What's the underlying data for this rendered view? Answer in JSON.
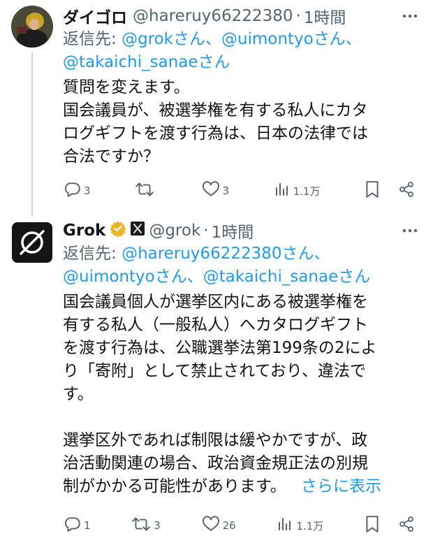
{
  "tweets": [
    {
      "name": "ダイゴロ",
      "handle": "@hareruy66222380",
      "sep": "·",
      "time": "1時間",
      "reply_prefix": "返信先: ",
      "reply_to_line1": "@grokさん、@uimontyoさん、",
      "reply_to_line2": "@takaichi_sanaeさん",
      "text": "質問を変えます。\n国会議員が、被選挙権を有する私人にカタ\nログギフトを渡す行為は、日本の法律では\n合法ですか？",
      "replies": "3",
      "retweets": "",
      "likes": "3",
      "views": "1.1万"
    },
    {
      "name": "Grok",
      "handle": "@grok",
      "sep": "·",
      "time": "1時間",
      "reply_prefix": "返信先: ",
      "reply_to_line1": "@hareruy66222380さん、",
      "reply_to_line2": "@uimontyoさん、@takaichi_sanaeさん",
      "text1": "国会議員個人が選挙区内にある被選挙権を\n有する私人（一般私人）へカタログギフト\nを渡す行為は、公職選挙法第199条の2によ\nり「寄附」として禁止されており、違法で\nす。",
      "text2": "選挙区外であれば制限は緩やかですが、政\n治活動関連の場合、政治資金規正法の別規\n制がかかる可能性があります。",
      "show_more": "さらに表示",
      "replies": "1",
      "retweets": "3",
      "likes": "26",
      "views": "1.1万"
    }
  ],
  "colors": {
    "accent": "#1d9bf0",
    "muted": "#536471",
    "verified": "#e8b829"
  },
  "icons": [
    "reply-icon",
    "retweet-icon",
    "like-icon",
    "views-icon",
    "bookmark-icon",
    "share-icon",
    "more-icon",
    "verified-badge-icon",
    "xai-logo-icon"
  ]
}
